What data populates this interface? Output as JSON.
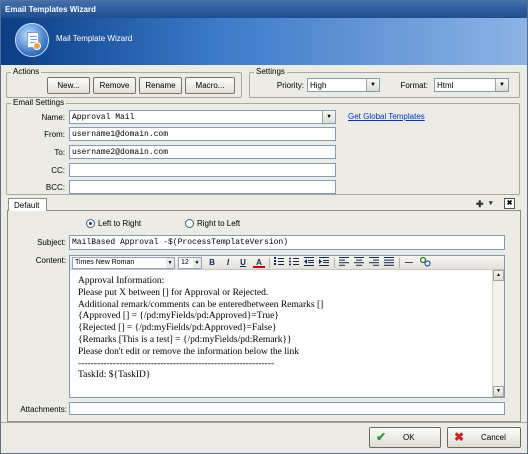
{
  "window": {
    "title": "Email Templates Wizard",
    "banner_title": "Mail Template Wizard"
  },
  "actions": {
    "legend": "Actions",
    "new_label": "New...",
    "remove_label": "Remove",
    "rename_label": "Rename",
    "macro_label": "Macro..."
  },
  "settings": {
    "legend": "Settings",
    "priority_label": "Priority:",
    "priority_value": "High",
    "format_label": "Format:",
    "format_value": "Html"
  },
  "email_settings": {
    "legend": "Email Settings",
    "name_label": "Name:",
    "name_value": "Approval Mail",
    "global_link": "Get Global Templates",
    "from_label": "From:",
    "from_value": "username1@domain.com",
    "to_label": "To:",
    "to_value": "username2@domain.com",
    "cc_label": "CC:",
    "cc_value": "",
    "bcc_label": "BCC:",
    "bcc_value": ""
  },
  "tabs": {
    "default_label": "Default",
    "add_glyph": "✚",
    "dropdown_glyph": "▾",
    "close_glyph": "✖"
  },
  "direction": {
    "ltr_label": "Left to Right",
    "rtl_label": "Right to Left",
    "selected": "ltr"
  },
  "subject": {
    "label": "Subject:",
    "value": "MailBased Approval -$(ProcessTemplateVersion)"
  },
  "content": {
    "label": "Content:",
    "font_value": "Times New Roman",
    "size_value": "12",
    "bold_glyph": "B",
    "italic_glyph": "I",
    "underline_glyph": "U",
    "color_glyph": "A",
    "hr_glyph": "—",
    "lines": [
      "Approval Information:",
      "Please put X between [] for Approval or Rejected.",
      "Additional remark/comments can be enteredbetween Remarks []",
      "{Approved [] = {/pd:myFields/pd:Approved}=True}",
      "{Rejected [] = {/pd:myFields/pd:Approved}=False}",
      "{Remarks [This is a test] = {/pd:myFields/pd:Remark}}",
      "Please don't edit or remove the information below the link",
      "--------------------------------------------------------------",
      "TaskId: ${TaskID}"
    ]
  },
  "attachments": {
    "label": "Attachments:",
    "value": ""
  },
  "footer": {
    "ok_label": "OK",
    "cancel_label": "Cancel",
    "ok_icon": "✔",
    "cancel_icon": "✖"
  },
  "colors": {
    "title_bar": "#2a5a9e",
    "link": "#0033cc",
    "ok_icon": "#2e9a2e",
    "cancel_icon": "#cc2222"
  }
}
